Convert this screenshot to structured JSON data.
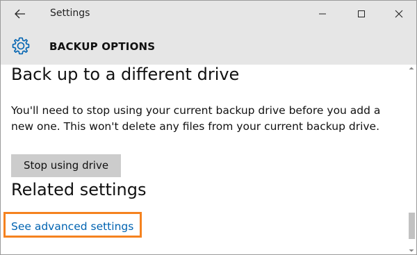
{
  "window": {
    "title": "Settings"
  },
  "header": {
    "title": "BACKUP OPTIONS",
    "icon": "gear-icon"
  },
  "section": {
    "title": "Back up to a different drive",
    "description": "You'll need to stop using your current backup drive before you add a new one. This won't delete any files from your current backup drive.",
    "button_label": "Stop using drive"
  },
  "related": {
    "title": "Related settings",
    "link_label": "See advanced settings"
  },
  "colors": {
    "link": "#0063b1",
    "highlight": "#f5821f",
    "titlebar": "#e6e6e6",
    "button": "#cccccc"
  }
}
